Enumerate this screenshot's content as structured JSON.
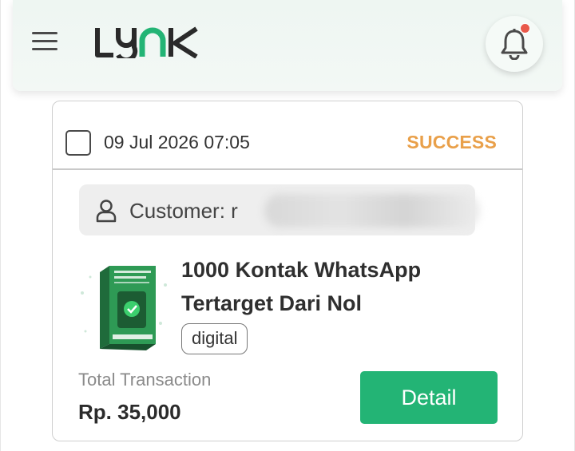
{
  "header": {
    "logo_text": "LYNK",
    "menu_icon": "hamburger-menu-icon",
    "bell_icon": "bell-icon",
    "notification_dot_color": "#e9594a",
    "brand_color": "#23b475"
  },
  "order": {
    "date": "09 Jul 2026 07:05",
    "status": "SUCCESS",
    "status_color": "#e9a04a",
    "customer_label": "Customer: r",
    "product_title": "1000 Kontak WhatsApp Tertarget Dari Nol",
    "product_tag": "digital",
    "total_label": "Total Transaction",
    "total_value": "Rp. 35,000",
    "detail_label": "Detail"
  }
}
